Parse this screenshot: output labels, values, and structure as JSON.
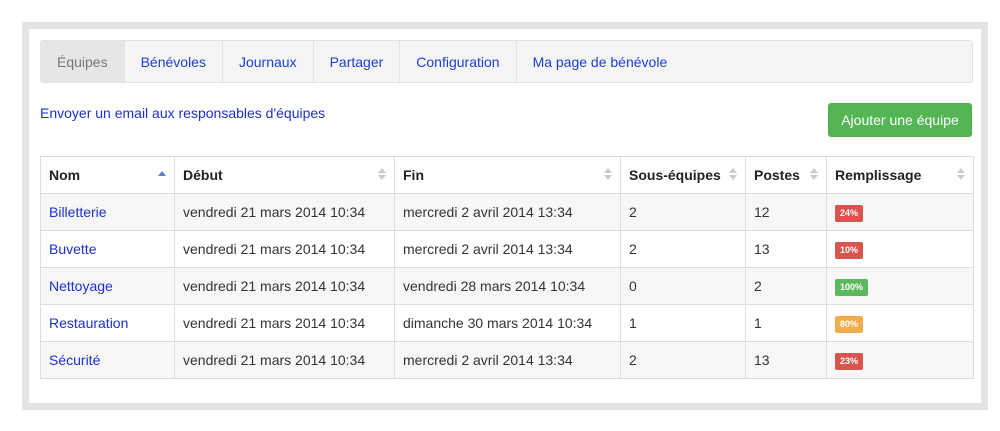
{
  "tabs": [
    {
      "label": "Équipes",
      "active": true
    },
    {
      "label": "Bénévoles",
      "active": false
    },
    {
      "label": "Journaux",
      "active": false
    },
    {
      "label": "Partager",
      "active": false
    },
    {
      "label": "Configuration",
      "active": false
    },
    {
      "label": "Ma page de bénévole",
      "active": false
    }
  ],
  "actions": {
    "email_link": "Envoyer un email aux responsables d'équipes",
    "add_button": "Ajouter une équipe"
  },
  "table": {
    "columns": [
      "Nom",
      "Début",
      "Fin",
      "Sous-équipes",
      "Postes",
      "Remplissage"
    ],
    "sorted_column": "Nom",
    "rows": [
      {
        "nom": "Billetterie",
        "debut": "vendredi 21 mars 2014 10:34",
        "fin": "mercredi 2 avril 2014 13:34",
        "sous_equipes": "2",
        "postes": "12",
        "remplissage": "24%",
        "status": "danger"
      },
      {
        "nom": "Buvette",
        "debut": "vendredi 21 mars 2014 10:34",
        "fin": "mercredi 2 avril 2014 13:34",
        "sous_equipes": "2",
        "postes": "13",
        "remplissage": "10%",
        "status": "danger"
      },
      {
        "nom": "Nettoyage",
        "debut": "vendredi 21 mars 2014 10:34",
        "fin": "vendredi 28 mars 2014 10:34",
        "sous_equipes": "0",
        "postes": "2",
        "remplissage": "100%",
        "status": "success"
      },
      {
        "nom": "Restauration",
        "debut": "vendredi 21 mars 2014 10:34",
        "fin": "dimanche 30 mars 2014 10:34",
        "sous_equipes": "1",
        "postes": "1",
        "remplissage": "80%",
        "status": "warning"
      },
      {
        "nom": "Sécurité",
        "debut": "vendredi 21 mars 2014 10:34",
        "fin": "mercredi 2 avril 2014 13:34",
        "sous_equipes": "2",
        "postes": "13",
        "remplissage": "23%",
        "status": "danger"
      }
    ]
  },
  "colors": {
    "link": "#1a2fd6",
    "success": "#5cb85c",
    "warning": "#f0ad4e",
    "danger": "#d9534f",
    "button": "#54b554"
  }
}
